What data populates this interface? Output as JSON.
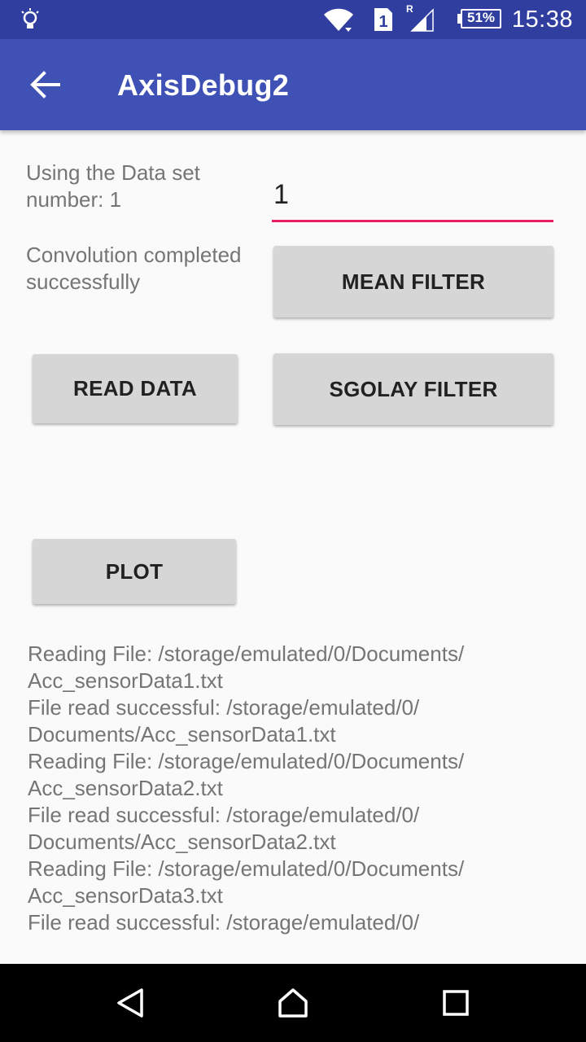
{
  "status_bar": {
    "time": "15:38",
    "battery": "51%",
    "sim_slot": "1",
    "roaming": "R",
    "icons": [
      "lightbulb-icon",
      "wifi-icon",
      "sim-icon",
      "signal-icon",
      "battery-icon"
    ]
  },
  "app_bar": {
    "title": "AxisDebug2",
    "back_icon": "arrow-back-icon"
  },
  "main": {
    "dataset_label": "Using the Data set number: 1",
    "dataset_input_value": "1",
    "convolution_status": "Convolution completed successfully",
    "buttons": {
      "mean_filter": "MEAN FILTER",
      "read_data": "READ DATA",
      "sgolay_filter": "SGOLAY FILTER",
      "plot": "PLOT"
    },
    "log_lines": [
      "Reading File: /storage/emulated/0/Documents/",
      "Acc_sensorData1.txt",
      "File read successful: /storage/emulated/0/",
      "Documents/Acc_sensorData1.txt",
      "Reading File: /storage/emulated/0/Documents/",
      "Acc_sensorData2.txt",
      "File read successful: /storage/emulated/0/",
      "Documents/Acc_sensorData2.txt",
      "Reading File: /storage/emulated/0/Documents/",
      "Acc_sensorData3.txt",
      "File read successful: /storage/emulated/0/"
    ]
  },
  "nav_bar": {
    "icons": [
      "back-triangle-icon",
      "home-icon",
      "recents-icon"
    ]
  },
  "colors": {
    "status_bar": "#303f9f",
    "app_bar": "#3f51b5",
    "accent": "#e91e63",
    "button": "#d6d6d6",
    "secondary_text": "#757575"
  }
}
